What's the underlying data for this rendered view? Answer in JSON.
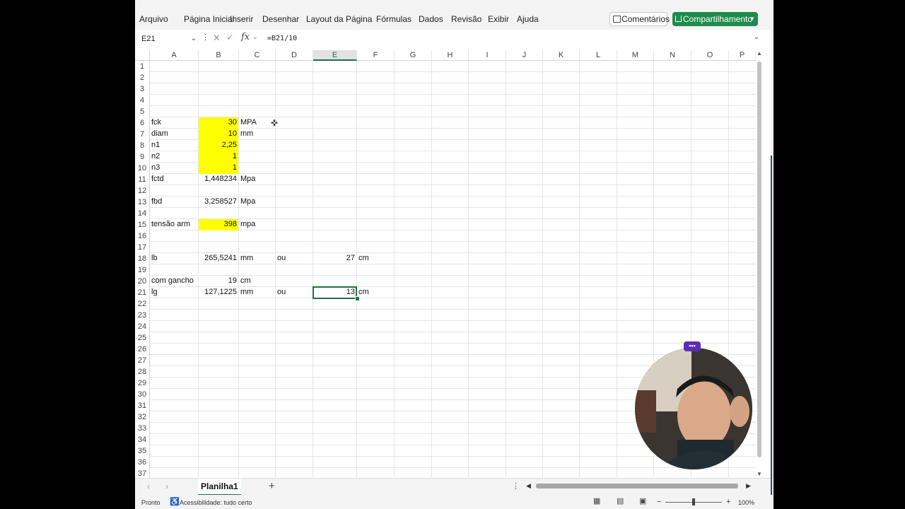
{
  "menu": {
    "items": [
      "Arquivo",
      "Página Inicial",
      "Inserir",
      "Desenhar",
      "Layout da Página",
      "Fórmulas",
      "Dados",
      "Revisão",
      "Exibir",
      "Ajuda"
    ],
    "comments_label": "Comentários",
    "share_label": "Compartilhamento"
  },
  "formula_bar": {
    "name_box": "E21",
    "fx": "fx",
    "formula": "=B21/10"
  },
  "columns": [
    "A",
    "B",
    "C",
    "D",
    "E",
    "F",
    "G",
    "H",
    "I",
    "J",
    "K",
    "L",
    "M",
    "N",
    "O",
    "P"
  ],
  "selected_column": "E",
  "rows": [
    1,
    2,
    3,
    4,
    5,
    6,
    7,
    8,
    9,
    10,
    11,
    12,
    13,
    14,
    15,
    16,
    17,
    18,
    19,
    20,
    21,
    22,
    23,
    24,
    25,
    26,
    27,
    28,
    29,
    30,
    31,
    32,
    33,
    34,
    35,
    36,
    37
  ],
  "selected_cell": "E21",
  "cells": [
    {
      "ref": "A6",
      "value": "fck"
    },
    {
      "ref": "B6",
      "value": "30",
      "num": true,
      "yellow": true
    },
    {
      "ref": "C6",
      "value": "MPA"
    },
    {
      "ref": "A7",
      "value": "diam"
    },
    {
      "ref": "B7",
      "value": "10",
      "num": true,
      "yellow": true
    },
    {
      "ref": "C7",
      "value": "mm"
    },
    {
      "ref": "A8",
      "value": "n1"
    },
    {
      "ref": "B8",
      "value": "2,25",
      "num": true,
      "yellow": true
    },
    {
      "ref": "A9",
      "value": "n2"
    },
    {
      "ref": "B9",
      "value": "1",
      "num": true,
      "yellow": true
    },
    {
      "ref": "A10",
      "value": "n3"
    },
    {
      "ref": "B10",
      "value": "1",
      "num": true,
      "yellow": true
    },
    {
      "ref": "A11",
      "value": "fctd"
    },
    {
      "ref": "B11",
      "value": "1,448234",
      "num": true
    },
    {
      "ref": "C11",
      "value": "Mpa"
    },
    {
      "ref": "A13",
      "value": "fbd"
    },
    {
      "ref": "B13",
      "value": "3,258527",
      "num": true
    },
    {
      "ref": "C13",
      "value": "Mpa"
    },
    {
      "ref": "A15",
      "value": "tensão arm"
    },
    {
      "ref": "B15",
      "value": "398",
      "num": true,
      "yellow": true
    },
    {
      "ref": "C15",
      "value": "mpa"
    },
    {
      "ref": "A18",
      "value": "lb"
    },
    {
      "ref": "B18",
      "value": "265,5241",
      "num": true
    },
    {
      "ref": "C18",
      "value": "mm"
    },
    {
      "ref": "D18",
      "value": "ou"
    },
    {
      "ref": "E18",
      "value": "27",
      "num": true
    },
    {
      "ref": "F18",
      "value": "cm"
    },
    {
      "ref": "A20",
      "value": "com gancho"
    },
    {
      "ref": "B20",
      "value": "19",
      "num": true
    },
    {
      "ref": "C20",
      "value": "cm"
    },
    {
      "ref": "A21",
      "value": "lg"
    },
    {
      "ref": "B21",
      "value": "127,1225",
      "num": true
    },
    {
      "ref": "C21",
      "value": "mm"
    },
    {
      "ref": "D21",
      "value": "ou"
    },
    {
      "ref": "E21",
      "value": "13",
      "num": true
    },
    {
      "ref": "F21",
      "value": "cm"
    }
  ],
  "sheet_tab": "Planilha1",
  "status": {
    "ready": "Pronto",
    "accessibility": "Acessibilidade: tudo certo",
    "zoom": "100%"
  },
  "colors": {
    "accent": "#1e7145",
    "share": "#1f8b4c",
    "highlight": "#ffff00"
  },
  "webcam_badge": "•••"
}
